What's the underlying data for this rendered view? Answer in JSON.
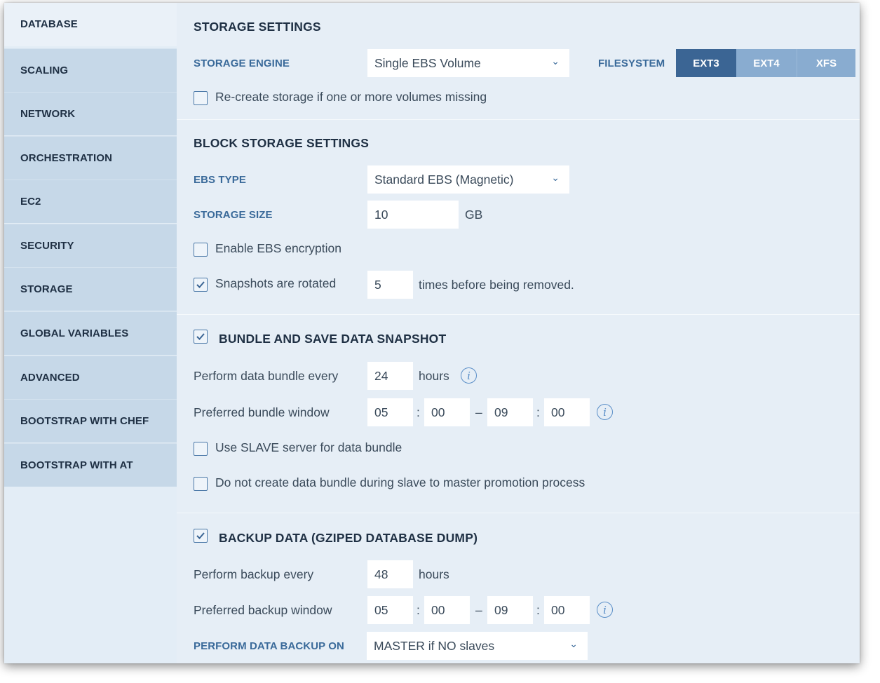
{
  "sidebar": {
    "items": [
      {
        "label": "DATABASE"
      },
      {
        "label": "SCALING"
      },
      {
        "label": "NETWORK"
      },
      {
        "label": "ORCHESTRATION"
      },
      {
        "label": "EC2"
      },
      {
        "label": "SECURITY"
      },
      {
        "label": "STORAGE"
      },
      {
        "label": "GLOBAL VARIABLES"
      },
      {
        "label": "ADVANCED"
      },
      {
        "label": "BOOTSTRAP WITH CHEF"
      },
      {
        "label": "BOOTSTRAP WITH AT"
      }
    ],
    "active": "DATABASE"
  },
  "storage": {
    "title": "STORAGE SETTINGS",
    "engine_label": "STORAGE ENGINE",
    "engine_value": "Single EBS Volume",
    "filesystem_label": "FILESYSTEM",
    "filesystem_options": [
      "EXT3",
      "EXT4",
      "XFS"
    ],
    "filesystem_selected": "EXT3",
    "recreate_label": "Re-create storage if one or more volumes missing",
    "recreate_checked": false
  },
  "block": {
    "title": "BLOCK STORAGE SETTINGS",
    "ebs_type_label": "EBS TYPE",
    "ebs_type_value": "Standard EBS (Magnetic)",
    "size_label": "STORAGE SIZE",
    "size_value": "10",
    "size_unit": "GB",
    "encryption_label": "Enable EBS encryption",
    "encryption_checked": false,
    "snapshots_label": "Snapshots are rotated",
    "snapshots_checked": true,
    "snapshots_value": "5",
    "snapshots_suffix": "times before being removed."
  },
  "bundle": {
    "title": "BUNDLE AND SAVE DATA SNAPSHOT",
    "checked": true,
    "every_label": "Perform data bundle every",
    "every_value": "24",
    "every_unit": "hours",
    "window_label": "Preferred bundle window",
    "window_start_h": "05",
    "window_start_m": "00",
    "window_end_h": "09",
    "window_end_m": "00",
    "colon": ":",
    "dash": "–",
    "slave_label": "Use SLAVE server for data bundle",
    "slave_checked": false,
    "promotion_label": "Do not create data bundle during slave to master promotion process",
    "promotion_checked": false
  },
  "backup": {
    "title": "BACKUP DATA (GZIPED DATABASE DUMP)",
    "checked": true,
    "every_label": "Perform backup every",
    "every_value": "48",
    "every_unit": "hours",
    "window_label": "Preferred backup window",
    "window_start_h": "05",
    "window_start_m": "00",
    "window_end_h": "09",
    "window_end_m": "00",
    "on_label": "PERFORM DATA BACKUP ON",
    "on_value": "MASTER if NO slaves"
  },
  "icons": {
    "info": "info-icon",
    "chevron": "chevron-down-icon",
    "check": "check-icon"
  },
  "colors": {
    "segment_active": "#3b6594",
    "segment_inactive": "#89acd0",
    "label_blue": "#3a6a9a",
    "info_blue": "#5b8fc8"
  }
}
